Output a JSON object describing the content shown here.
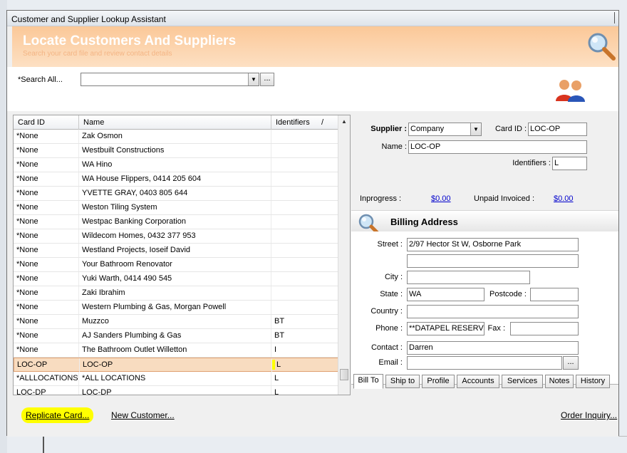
{
  "window": {
    "title": "Customer and Supplier Lookup Assistant"
  },
  "banner": {
    "heading": "Locate Customers And Suppliers",
    "subtitle": "Search your card file and review contact details"
  },
  "search": {
    "label": "*Search All...",
    "value": "",
    "browse_label": "...",
    "dropdown_arrow": "▼"
  },
  "list": {
    "columns": [
      "Card ID",
      "Name",
      "Identifiers"
    ],
    "sort_indicator": "/",
    "rows": [
      {
        "card_id": "*None",
        "name": "Zak Osmon",
        "identifiers": ""
      },
      {
        "card_id": "*None",
        "name": "Westbuilt Constructions",
        "identifiers": ""
      },
      {
        "card_id": "*None",
        "name": "WA Hino",
        "identifiers": ""
      },
      {
        "card_id": "*None",
        "name": "WA House Flippers, 0414 205 604",
        "identifiers": ""
      },
      {
        "card_id": "*None",
        "name": "YVETTE GRAY, 0403 805 644",
        "identifiers": ""
      },
      {
        "card_id": "*None",
        "name": "Weston Tiling System",
        "identifiers": ""
      },
      {
        "card_id": "*None",
        "name": "Westpac Banking Corporation",
        "identifiers": ""
      },
      {
        "card_id": "*None",
        "name": "Wildecom Homes, 0432 377 953",
        "identifiers": ""
      },
      {
        "card_id": "*None",
        "name": "Westland Projects, Ioseif David",
        "identifiers": ""
      },
      {
        "card_id": "*None",
        "name": "Your Bathroom Renovator",
        "identifiers": ""
      },
      {
        "card_id": "*None",
        "name": "Yuki Warth, 0414 490 545",
        "identifiers": ""
      },
      {
        "card_id": "*None",
        "name": "Zaki Ibrahim",
        "identifiers": ""
      },
      {
        "card_id": "*None",
        "name": "Western Plumbing & Gas, Morgan Powell",
        "identifiers": ""
      },
      {
        "card_id": "*None",
        "name": "Muzzco",
        "identifiers": "BT"
      },
      {
        "card_id": "*None",
        "name": "AJ Sanders Plumbing & Gas",
        "identifiers": "BT"
      },
      {
        "card_id": "*None",
        "name": "The Bathroom Outlet Willetton",
        "identifiers": "I"
      },
      {
        "card_id": "LOC-OP",
        "name": "LOC-OP",
        "identifiers": "L",
        "selected": true
      },
      {
        "card_id": "*ALLLOCATIONS",
        "name": "*ALL LOCATIONS",
        "identifiers": "L"
      },
      {
        "card_id": "LOC-DP",
        "name": "LOC-DP",
        "identifiers": "L"
      }
    ]
  },
  "detail": {
    "type_label": "Supplier :",
    "type_value": "Company",
    "card_id_label": "Card ID :",
    "card_id_value": "LOC-OP",
    "name_label": "Name :",
    "name_value": "LOC-OP",
    "identifiers_label": "Identifiers :",
    "identifiers_value": "L",
    "inprogress_label": "Inprogress :",
    "inprogress_value": "$0.00",
    "unpaid_label": "Unpaid Invoiced :",
    "unpaid_value": "$0.00"
  },
  "billing": {
    "heading": "Billing Address",
    "street_label": "Street :",
    "street1": "2/97 Hector St W, Osborne Park",
    "street2": "",
    "city_label": "City :",
    "city": "",
    "state_label": "State :",
    "state": "WA",
    "postcode_label": "Postcode :",
    "postcode": "",
    "country_label": "Country :",
    "country": "",
    "phone_label": "Phone :",
    "phone": "**DATAPEL RESERV",
    "fax_label": "Fax :",
    "fax": "",
    "contact_label": "Contact :",
    "contact": "Darren",
    "email_label": "Email :",
    "email": "",
    "email_btn": "..."
  },
  "tabs": [
    "Bill To",
    "Ship to",
    "Profile",
    "Accounts",
    "Services",
    "Notes",
    "History"
  ],
  "footer": {
    "replicate": "Replicate Card...",
    "new_customer": "New Customer...",
    "order_inquiry": "Order Inquiry..."
  },
  "colors": {
    "banner": "#fbc898",
    "selected_row": "#f8dcc0",
    "highlight": "#ffff00",
    "link": "#0000cc"
  }
}
